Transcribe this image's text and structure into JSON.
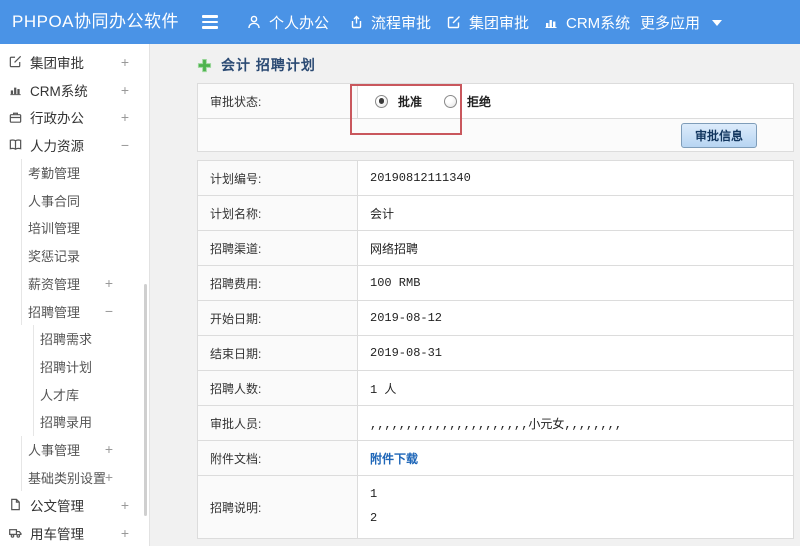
{
  "topbar": {
    "app_title": "PHPOA协同办公软件",
    "nav_items": [
      {
        "label": "个人办公",
        "icon": "person-icon"
      },
      {
        "label": "流程审批",
        "icon": "workflow-icon"
      },
      {
        "label": "集团审批",
        "icon": "edit-icon"
      },
      {
        "label": "CRM系统",
        "icon": "bar-chart-icon"
      },
      {
        "label": "更多应用",
        "icon": "caret-down-icon"
      }
    ]
  },
  "sidebar": {
    "items": [
      {
        "label": "集团审批",
        "toggle": "+",
        "icon": "edit-icon"
      },
      {
        "label": "CRM系统",
        "toggle": "+",
        "icon": "bar-chart-icon"
      },
      {
        "label": "行政办公",
        "toggle": "+",
        "icon": "briefcase-icon"
      },
      {
        "label": "人力资源",
        "toggle": "−",
        "icon": "book-icon"
      },
      {
        "label": "考勤管理"
      },
      {
        "label": "人事合同"
      },
      {
        "label": "培训管理"
      },
      {
        "label": "奖惩记录"
      },
      {
        "label": "薪资管理",
        "toggle": "+"
      },
      {
        "label": "招聘管理",
        "toggle": "−"
      },
      {
        "label": "招聘需求"
      },
      {
        "label": "招聘计划"
      },
      {
        "label": "人才库"
      },
      {
        "label": "招聘录用"
      },
      {
        "label": "人事管理",
        "toggle": "+"
      },
      {
        "label": "基础类别设置",
        "toggle": "+"
      },
      {
        "label": "公文管理",
        "toggle": "+",
        "icon": "document-icon"
      },
      {
        "label": "用车管理",
        "toggle": "+",
        "icon": "truck-icon"
      }
    ]
  },
  "main": {
    "page_title": "会计 招聘计划",
    "approval": {
      "label": "审批状态:",
      "options": [
        {
          "label": "批准",
          "selected": true
        },
        {
          "label": "拒绝",
          "selected": false
        }
      ],
      "button_label": "审批信息"
    },
    "detail_rows": [
      {
        "label": "计划编号:",
        "value": "20190812111340"
      },
      {
        "label": "计划名称:",
        "value": "会计"
      },
      {
        "label": "招聘渠道:",
        "value": "网络招聘"
      },
      {
        "label": "招聘费用:",
        "value": "100 RMB"
      },
      {
        "label": "开始日期:",
        "value": "2019-08-12"
      },
      {
        "label": "结束日期:",
        "value": "2019-08-31"
      },
      {
        "label": "招聘人数:",
        "value": "1 人"
      },
      {
        "label": "审批人员:",
        "value": ",,,,,,,,,,,,,,,,,,,,,,小元女,,,,,,,,"
      },
      {
        "label": "附件文档:",
        "value": "附件下载"
      },
      {
        "label": "招聘说明:",
        "lines": [
          "1",
          "2"
        ]
      }
    ]
  },
  "colors": {
    "topbar_blue": "#4a93e6",
    "annotation_red": "#c9575d",
    "link_blue": "#1e66b8",
    "plus_green": "#4db34d",
    "button_face": "#c5dcf5"
  }
}
